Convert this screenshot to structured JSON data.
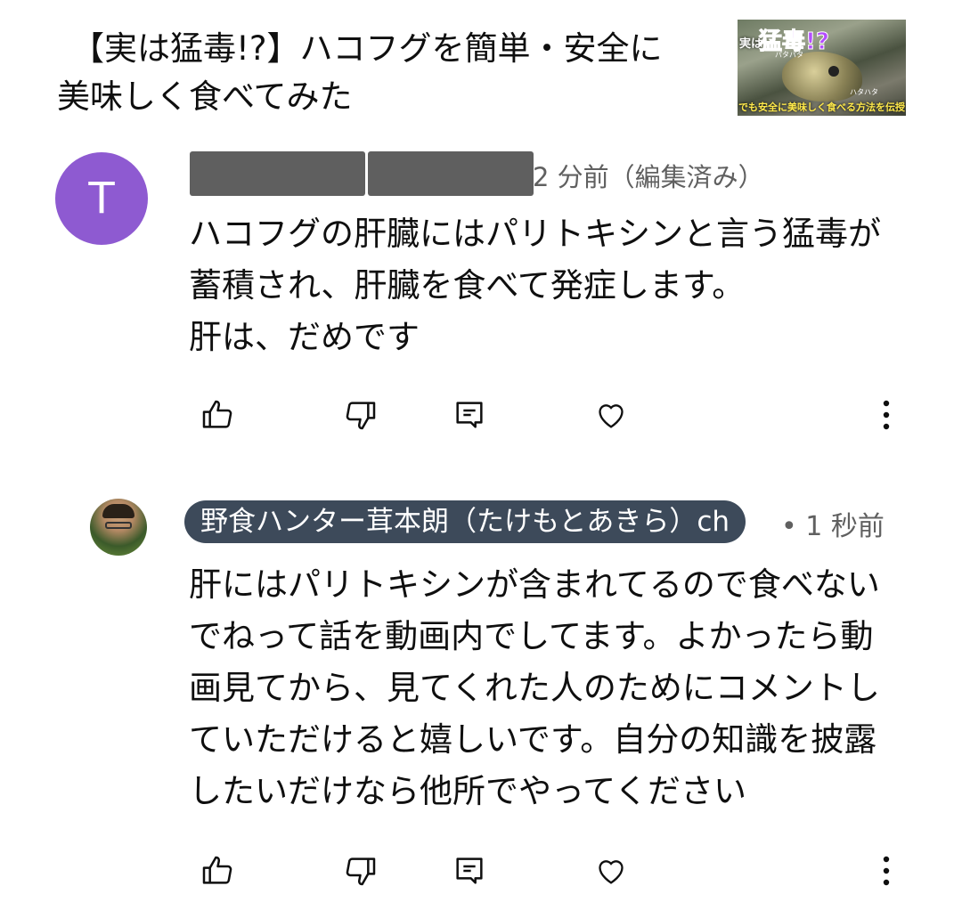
{
  "video": {
    "title_line1": "【実は猛毒!?】ハコフグを簡単・安全に",
    "title_line2": "美味しく食べてみた",
    "thumbnail": {
      "label_small": "実は",
      "label_big": "猛毒!?",
      "caption": "でも安全に美味しく食べる方法を伝授",
      "tag_a": "パタパタ",
      "tag_b": "ハタハタ"
    }
  },
  "comment": {
    "avatar_letter": "T",
    "avatar_color": "#8e5ad1",
    "meta": "2 分前（編集済み）",
    "lines": [
      "ハコフグの肝臓にはパリトキシンと言う猛毒が",
      "蓄積され、肝臓を食べて発症します。",
      "肝は、だめです"
    ]
  },
  "reply": {
    "author": "野食ハンター茸本朗（たけもとあきら）ch",
    "meta": "• 1 秒前",
    "lines": [
      "肝にはパリトキシンが含まれてるので食べない",
      "でねって話を動画内でしてます。よかったら動",
      "画見てから、見てくれた人のためにコメントし",
      "ていただけると嬉しいです。自分の知識を披露",
      "したいだけなら他所でやってください"
    ]
  },
  "icons": [
    "like-icon",
    "dislike-icon",
    "reply-icon",
    "heart-icon",
    "more-vert-icon"
  ],
  "colors": {
    "chip_bg": "#3d4a5a",
    "meta_text": "#606060",
    "redaction": "#5f5f5f"
  }
}
